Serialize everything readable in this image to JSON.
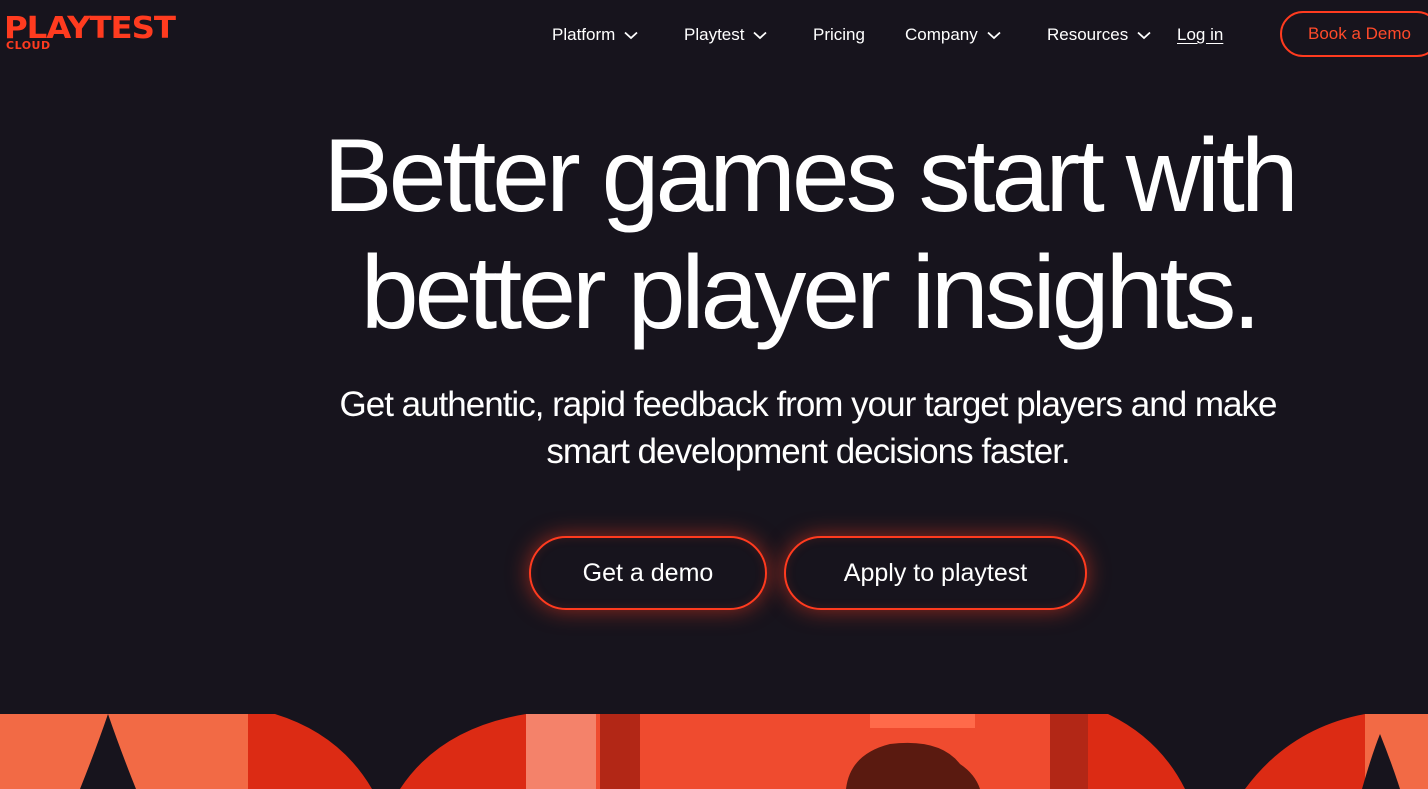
{
  "brand": {
    "logo_main": "PLAYTEST",
    "logo_sub": "CLOUD",
    "accent_color": "#ff3b1f",
    "background_color": "#17141d"
  },
  "nav": {
    "items": [
      {
        "label": "Platform",
        "has_dropdown": true
      },
      {
        "label": "Playtest",
        "has_dropdown": true
      },
      {
        "label": "Pricing",
        "has_dropdown": false
      },
      {
        "label": "Company",
        "has_dropdown": true
      },
      {
        "label": "Resources",
        "has_dropdown": true
      }
    ],
    "login_label": "Log in",
    "book_demo_label": "Book a Demo"
  },
  "hero": {
    "title_line1": "Better games start with",
    "title_line2": "better player insights.",
    "subtitle_line1": "Get authentic, rapid feedback from your target players and make",
    "subtitle_line2": "smart development decisions faster.",
    "cta_demo": "Get a demo",
    "cta_apply": "Apply to playtest"
  }
}
